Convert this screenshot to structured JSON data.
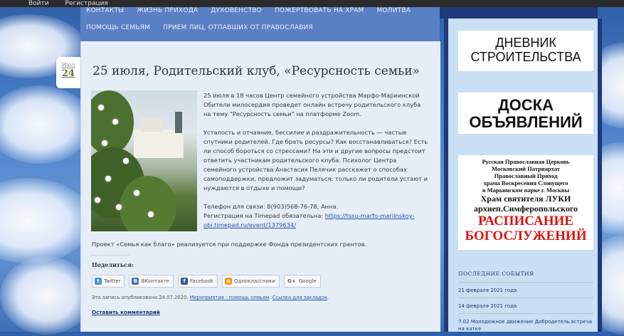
{
  "topbar": {
    "login": "Войти",
    "register": "Регистрация"
  },
  "nav": {
    "row1": [
      "КОНТАКТЫ",
      "ЖИЗНЬ ПРИХОДА",
      "ДУХОВЕНСТВО",
      "ПОЖЕРТВОВАТЬ НА ХРАМ",
      "МОЛИТВА"
    ],
    "row2": [
      "ПОМОЩЬ СЕМЬЯМ",
      "ПРИЕМ ЛИЦ, ОТПАВШИХ ОТ ПРАВОСЛАВИЯ"
    ]
  },
  "post": {
    "date_month": "Июл",
    "date_day": "24",
    "title": "25 июля, Родительский клуб, «Ресурсность семьи»",
    "p1": "25 июля в 18 часов Центр семейного устройства Марфо-Мариинской Обители милосердия проведет онлайн встречу родительского клуба на тему \"Ресурсность семьи\" на платформе Zoom.",
    "p2": "Усталость и отчаяние, бессилие и раздражительность — частые спутники родителей. Где брать ресурсы? Как восстанавливаться? Есть ли способ бороться со стрессами? На эти и другие вопросы предстоит ответить участникам родительского клуба. Психолог Центра семейного устройства Анастасия Пелячик расскажет о способах самоподдержки, предложит задуматься: только ли родители устают и нуждаются в отдыхе и помощи?",
    "phone": "Телефон для связи: 8(903)568-76-78, Анна.",
    "registration_prefix": "Регистрация на Timepad обязательна: ",
    "registration_link": "https://tssu-marfo-mariinskoy-obi.timepad.ru/event/1379634/",
    "project": "Проект «Семья как благо» реализуется при поддержке Фонда президентских грантов.",
    "share_label": "Поделиться:",
    "share_buttons": [
      {
        "label": "Twitter",
        "icon": "twitter-icon",
        "color": "#4a8fd6",
        "glyph": "t"
      },
      {
        "label": "ВКонтакте",
        "icon": "vk-icon",
        "color": "#4a6ea8",
        "glyph": "В"
      },
      {
        "label": "Facebook",
        "icon": "facebook-icon",
        "color": "#3b5998",
        "glyph": "f"
      },
      {
        "label": "Одноклассники",
        "icon": "odnoklassniki-icon",
        "color": "#f39a1c",
        "glyph": "o"
      },
      {
        "label": "Google",
        "icon": "google-icon",
        "color": "#ffffff",
        "glyph": "G+"
      }
    ],
    "meta_prefix": "Эта запись опубликована 24.07.2020. ",
    "meta_category": "Мероприятия - помощь семьям",
    "meta_sep": ". ",
    "meta_bookmark": "Ссылка для закладок",
    "meta_suffix": ".",
    "comment_link": "Оставить комментарий"
  },
  "sidebar": {
    "banner_diary": [
      "ДНЕВНИК",
      "СТРОИТЕЛЬСТВА"
    ],
    "banner_board": [
      "ДОСКА",
      "ОБЪЯВЛЕНИЙ"
    ],
    "church_lines": [
      "Русская Православная Церковь",
      "Московский Патриархат",
      "Православный Приход",
      "храма Воскресения Словущего",
      "в Марьинском парке  г. Москвы"
    ],
    "church_big": [
      "Храм святителя ЛУКИ",
      "архиеп.Симферопольского"
    ],
    "church_red": [
      "РАСПИСАНИЕ",
      "БОГОСЛУЖЕНИЙ"
    ],
    "events_title": "ПОСЛЕДНИЕ СОБЫТИЯ",
    "events": [
      "21 февраля 2021 года",
      "14 февраля 2021 года",
      "7.02 Молодежное движение Добродетель встреча на катке"
    ]
  }
}
